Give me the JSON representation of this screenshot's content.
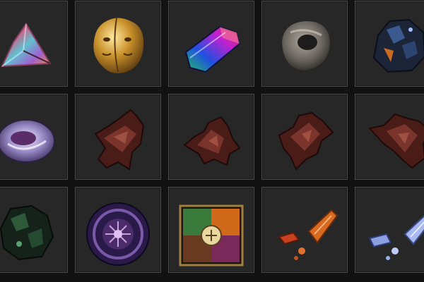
{
  "inventory": {
    "slots": [
      {
        "icon": "prismatic-shard-icon"
      },
      {
        "icon": "golden-twin-face-idol-icon"
      },
      {
        "icon": "rainbow-crystal-icon"
      },
      {
        "icon": "grey-stone-ring-icon"
      },
      {
        "icon": "dark-blue-ore-icon"
      },
      {
        "icon": "silver-violet-orb-icon"
      },
      {
        "icon": "dark-red-fragment-icon"
      },
      {
        "icon": "dark-red-fragment-icon"
      },
      {
        "icon": "dark-red-fragment-icon"
      },
      {
        "icon": "dark-red-fragment-icon"
      },
      {
        "icon": "dark-green-ore-icon"
      },
      {
        "icon": "purple-rune-disc-icon"
      },
      {
        "icon": "four-quadrant-emblem-icon"
      },
      {
        "icon": "orange-crystal-shards-icon"
      },
      {
        "icon": "pale-blue-crystal-shards-icon"
      }
    ]
  },
  "colors": {
    "background": "#121212",
    "slot_fill": "#272727",
    "slot_border": "#4a4a4a"
  }
}
